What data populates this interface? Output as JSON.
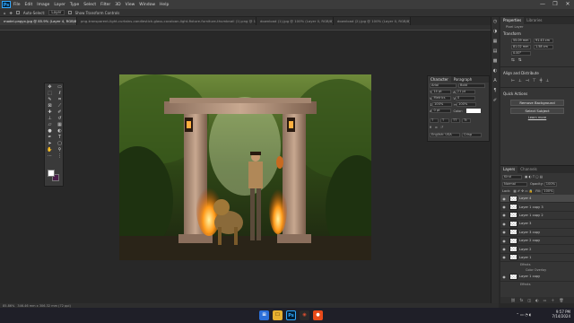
{
  "menubar": {
    "items": [
      "File",
      "Edit",
      "Image",
      "Layer",
      "Type",
      "Select",
      "Filter",
      "3D",
      "View",
      "Window",
      "Help"
    ],
    "window_controls": [
      "—",
      "❐",
      "✕"
    ]
  },
  "options": {
    "auto_select": "Auto-Select:",
    "target": "Layer",
    "transform": "Show Transform Controls"
  },
  "tabs": [
    "model-pngyx.jpg @ 85.9% (Layer 4, RGB/8)",
    "png-transparent-light-curtains-candlestick-glass-cocoloan-light-fixture-furniture-thumbnail (1).png @ 100% (Layer 0, RGB/8)",
    "download (1).jpg @ 100% (Layer 0, RGB/8)",
    "download (2).jpg @ 100% (Layer 0, RGB/8)"
  ],
  "statusbar": {
    "zoom": "85.86%",
    "info": "346.46 mm x 306.32 mm (72 ppi)"
  },
  "character_panel": {
    "tabs": [
      "Character",
      "Paragraph"
    ],
    "font": "Arial",
    "style": "Bold",
    "size": "14 pt",
    "leading": "21 pt",
    "kerning": "Metrics",
    "tracking": "0",
    "vscale": "100%",
    "hscale": "100%",
    "baseline": "0 pt",
    "color_label": "Color:",
    "language": "English: USA",
    "aa": "Crisp"
  },
  "properties": {
    "tabs": [
      "Properties",
      "Libraries"
    ],
    "pixel_layer": "Pixel Layer",
    "transform_title": "Transform",
    "w": "55.09 mm",
    "h": "81.02 mm",
    "x": "91.43 cm",
    "y": "1.58 cm",
    "angle": "0.00°",
    "align_title": "Align and Distribute",
    "quick_title": "Quick Actions",
    "remove_bg": "Remove Background",
    "select_subject": "Select Subject",
    "learn_more": "Learn more"
  },
  "layers": {
    "tabs": [
      "Layers",
      "Channels"
    ],
    "filter": "Kind",
    "blend": "Normal",
    "opacity_label": "Opacity:",
    "opacity": "100%",
    "lock_label": "Lock:",
    "fill_label": "Fill:",
    "fill": "100%",
    "items": [
      {
        "name": "Layer 4",
        "selected": true
      },
      {
        "name": "Layer 1 copy 3",
        "selected": false
      },
      {
        "name": "Layer 1 copy 2",
        "selected": false
      },
      {
        "name": "Layer 3",
        "selected": false
      },
      {
        "name": "Layer 3 copy",
        "selected": false
      },
      {
        "name": "Layer 2 copy",
        "selected": false
      },
      {
        "name": "Layer 2",
        "selected": false
      },
      {
        "name": "Layer 1",
        "selected": false
      }
    ],
    "effects_label": "Effects",
    "effect_item": "Color Overlay",
    "last_layer": "Layer 1 copy",
    "last_effects": "Effects"
  },
  "taskbar": {
    "apps": [
      "⊞",
      "🗀",
      "Ps",
      "◉",
      "●"
    ],
    "time": "9:57 PM",
    "date": "7/14/2024",
    "weather": "Partly sunny"
  }
}
